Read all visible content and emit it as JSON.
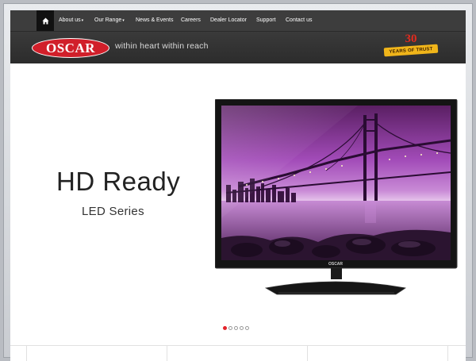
{
  "nav": {
    "home_icon": "home-icon",
    "items": [
      {
        "label": "About us",
        "has_dropdown": true
      },
      {
        "label": "Our Range",
        "has_dropdown": true
      },
      {
        "label": "News & Events",
        "has_dropdown": false
      },
      {
        "label": "Careers",
        "has_dropdown": false
      },
      {
        "label": "Dealer Locator",
        "has_dropdown": false
      },
      {
        "label": "Support",
        "has_dropdown": false
      },
      {
        "label": "Contact us",
        "has_dropdown": false
      }
    ]
  },
  "header": {
    "logo_text": "OSCAR",
    "tagline": "within heart within reach",
    "badge": {
      "number": "30",
      "text": "YEARS OF TRUST"
    }
  },
  "hero": {
    "title": "HD Ready",
    "subtitle": "LED Series",
    "tv_brand": "OSCAR"
  },
  "slider": {
    "slide_count": 5,
    "active_index": 0
  },
  "colors": {
    "brand_red": "#d11f2a",
    "nav_bg": "#3d3d3d",
    "badge_gold": "#f0b51a"
  }
}
